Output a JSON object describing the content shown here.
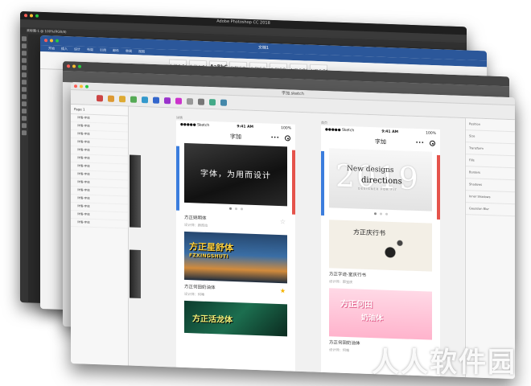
{
  "photoshop": {
    "title": "Adobe Photoshop CC 2018",
    "tab": "未标题-1 @ 100%(RGB/8)"
  },
  "word": {
    "title": "文档1",
    "tabs": [
      "开始",
      "插入",
      "设计",
      "布局",
      "引用",
      "邮件",
      "审阅",
      "视图"
    ],
    "styles": [
      "AaBbCcDd",
      "AaBbCcDd",
      "AaBbC",
      "AaBbCcD",
      "AaBbCcD",
      "AaBbCcD",
      "AaBbCcDd",
      "AaBbCcDd"
    ]
  },
  "sketch": {
    "title": "字加.sketch",
    "pages_label": "Page 1",
    "layers": [
      "详情-字体",
      "详情-字体",
      "详情-字体",
      "详情-字体",
      "详情-字体",
      "详情-字体",
      "详情-字体",
      "详情-字体",
      "详情-字体",
      "详情-字体",
      "详情-字体",
      "详情-字体",
      "详情-字体",
      "详情-字体"
    ],
    "inspector": [
      "Position",
      "Size",
      "Transform",
      "Fills",
      "Borders",
      "Shadows",
      "Inner Shadows",
      "Gaussian Blur"
    ],
    "tool_colors": [
      "#c44",
      "#d93",
      "#da3",
      "#5a5",
      "#39c",
      "#36c",
      "#93c",
      "#c3c",
      "#999",
      "#777",
      "#4a8",
      "#48a"
    ]
  },
  "phone_left": {
    "artboard_label": "详情",
    "status_carrier": "●●●●● Sketch",
    "status_time": "9:41 AM",
    "status_battery": "100%",
    "nav_title": "字加",
    "banner_text": "字体，为用而设计",
    "cards": [
      {
        "title": "方正姚明体",
        "designer": "设计师：颜而拉",
        "image_title": "方正星舒体",
        "image_sub": "FZXINGSHUTI",
        "starred": false
      },
      {
        "title": "方正何田奶油体",
        "designer": "设计师：何唯",
        "image_title": "方正活龙体",
        "image_sub": "",
        "starred": true
      }
    ]
  },
  "phone_right": {
    "artboard_label": "首页",
    "status_carrier": "●●●●● Sketch",
    "status_time": "9:41 AM",
    "status_battery": "100%",
    "nav_title": "字加",
    "banner_big": "2019",
    "banner_line1": "New designs",
    "banner_line2": "directions",
    "banner_line3": "DESIGNER FOR FIT",
    "cards": [
      {
        "title": "方正字迹-室庆行书",
        "designer": "设计师：郭宝庆",
        "image_title": "方正庆行书"
      },
      {
        "title": "方正何田奶油体",
        "designer": "设计师：何唯",
        "image_title": "方正何田",
        "image_sub": "奶油体"
      }
    ]
  },
  "watermark": "人人软件园"
}
